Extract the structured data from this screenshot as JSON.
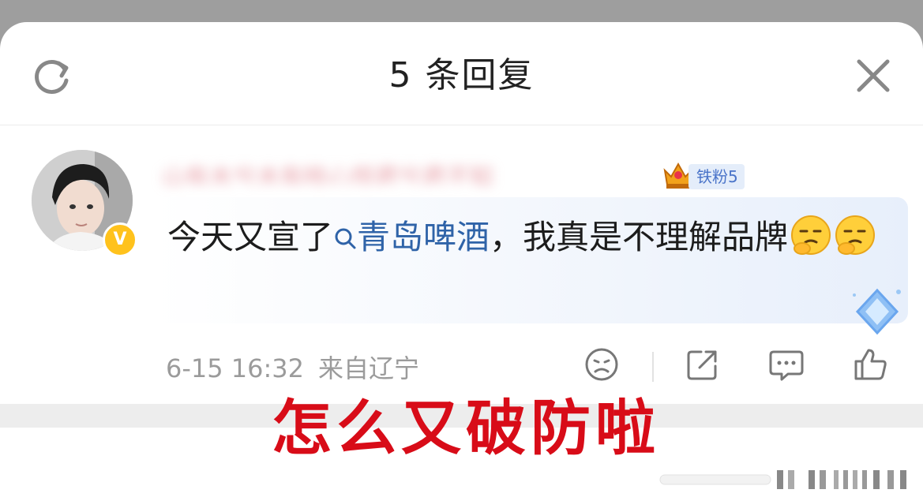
{
  "header": {
    "title": "5 条回复",
    "left_icon": "refresh-icon",
    "right_icon": "close-icon"
  },
  "comment": {
    "avatar_badge": "V",
    "username": "山有木兮木有枝心悦君兮君不知",
    "fan_badge": {
      "label": "铁粉5",
      "level": 5,
      "icon": "crown-icon"
    },
    "text_before": "今天又宣了",
    "topic": "青岛啤酒",
    "text_after": "，我真是不理解品牌",
    "emojis": [
      "thinking-face-emoji",
      "thinking-face-emoji"
    ],
    "time": "6-15 16:32",
    "location": "来自辽宁",
    "actions": [
      "dislike-face-icon",
      "share-icon",
      "comment-icon",
      "like-icon"
    ]
  },
  "overlay_caption": "怎么又破防啦",
  "colors": {
    "link": "#2f63a8",
    "caption": "#d80c18",
    "vip_badge": "#ffc21c",
    "fan_badge_text": "#4a74c9"
  }
}
